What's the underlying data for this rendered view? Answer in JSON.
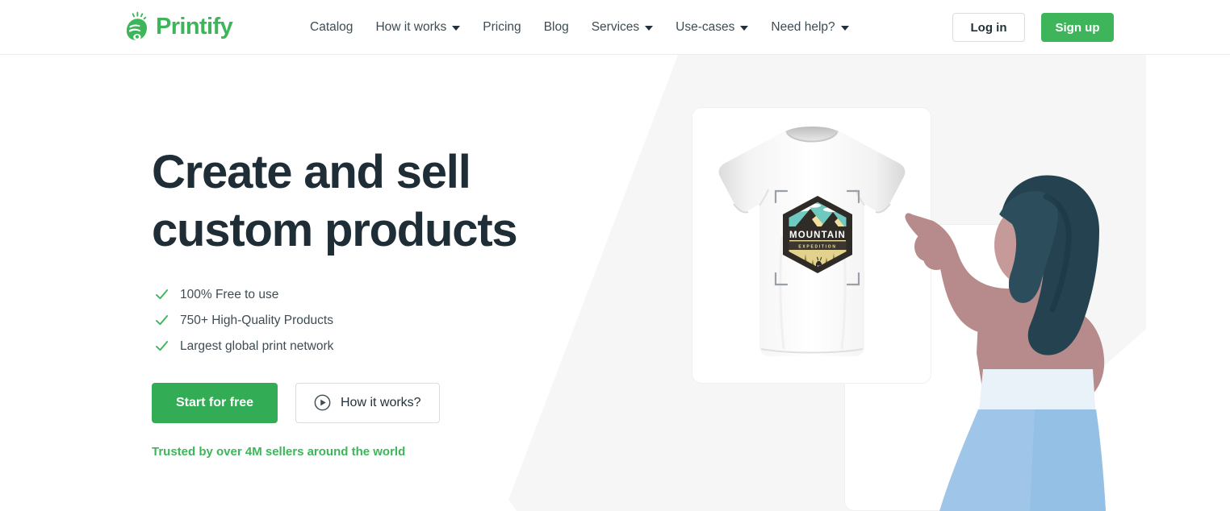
{
  "brand": {
    "name": "Printify",
    "logo_icon": "printify-hand-logo-icon",
    "color": "#3eb55b"
  },
  "header": {
    "nav": [
      {
        "label": "Catalog",
        "has_dropdown": false
      },
      {
        "label": "How it works",
        "has_dropdown": true
      },
      {
        "label": "Pricing",
        "has_dropdown": false
      },
      {
        "label": "Blog",
        "has_dropdown": false
      },
      {
        "label": "Services",
        "has_dropdown": true
      },
      {
        "label": "Use-cases",
        "has_dropdown": true
      },
      {
        "label": "Need help?",
        "has_dropdown": true
      }
    ],
    "login_label": "Log in",
    "signup_label": "Sign up"
  },
  "hero": {
    "headline": "Create and sell\ncustom products",
    "features": [
      {
        "label": "100% Free to use"
      },
      {
        "label": "750+ High-Quality Products"
      },
      {
        "label": "Largest global print network"
      }
    ],
    "primary_cta": "Start for free",
    "secondary_cta": "How it works?",
    "secondary_cta_icon": "play-circle-icon",
    "trust_text": "Trusted by over 4M sellers around the world",
    "trust_color": "#3eb55b",
    "primary_cta_color": "#33ad55"
  },
  "artwork": {
    "shirt_card": {
      "product": "white t-shirt mockup",
      "design_title": "MOUNTAIN",
      "design_subtitle": "EXPEDITION",
      "design_shape": "hexagon-badge",
      "design_colors": {
        "sky": "#6ec9c0",
        "sand": "#f0e0a0",
        "dark": "#2f2b26",
        "white": "#ffffff"
      },
      "selection_handles_icon": "crop-corner-handles-icon"
    },
    "illustration": {
      "subject": "woman pointing at t-shirt",
      "colors": {
        "hair": "#24424f",
        "skin": "#b78b8b",
        "skirt": "#9fc6e8",
        "top": "#e6f0f8"
      }
    },
    "background_shape_color": "#f6f6f6"
  }
}
